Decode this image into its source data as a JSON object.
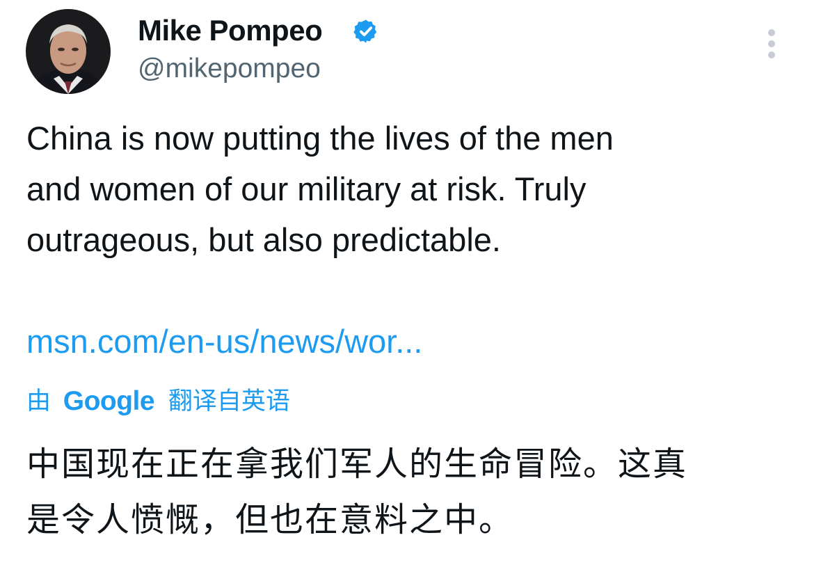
{
  "author": {
    "display_name": "Mike Pompeo",
    "handle": "@mikepompeo",
    "verified": true,
    "verified_color": "#1d9bf0"
  },
  "tweet": {
    "text": "China is now putting the lives of the men\nand women of our military at risk. Truly\noutrageous, but also predictable.",
    "link_text": "msn.com/en-us/news/wor..."
  },
  "translation": {
    "prefix": "由",
    "brand": "Google",
    "suffix": "翻译自英语",
    "text": "中国现在正在拿我们军人的生命冒险。这真\n是令人愤慨，但也在意料之中。"
  },
  "icons": {
    "verified": "verified-badge-icon",
    "more": "more-options-icon"
  },
  "colors": {
    "accent": "#1d9bf0",
    "text": "#0f1419",
    "secondary": "#536471"
  }
}
